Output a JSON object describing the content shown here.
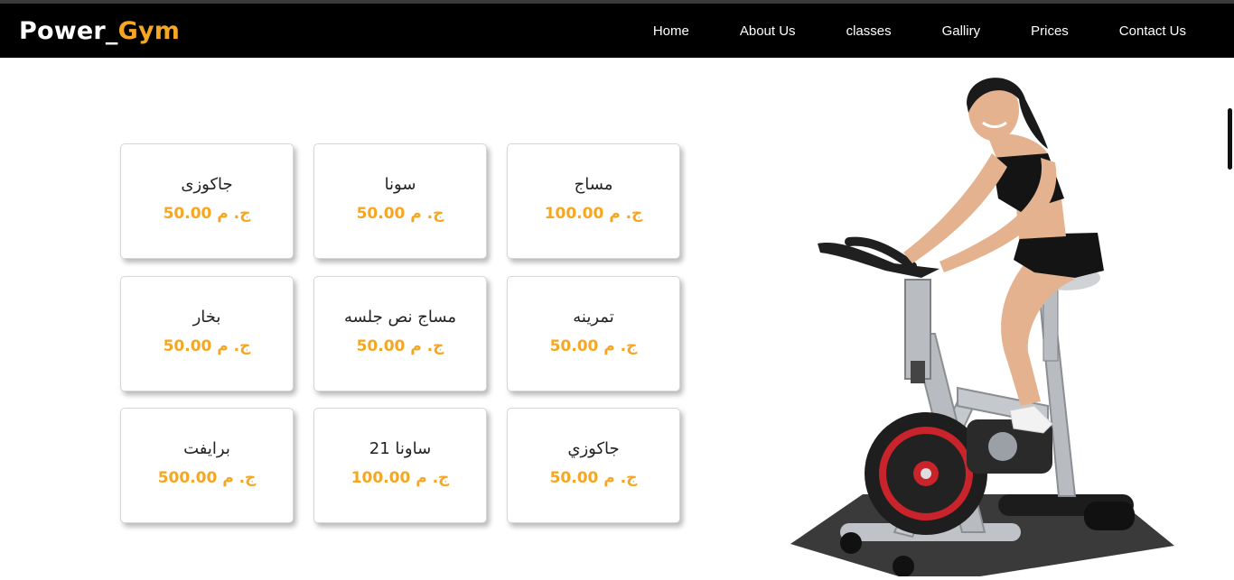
{
  "brand": {
    "main": "Power_",
    "accent": "Gym"
  },
  "nav": {
    "items": [
      {
        "label": "Home"
      },
      {
        "label": "About Us"
      },
      {
        "label": "classes"
      },
      {
        "label": "Galliry"
      },
      {
        "label": "Prices"
      },
      {
        "label": "Contact Us"
      }
    ]
  },
  "prices": {
    "rows": [
      [
        {
          "name": "جاكوزى",
          "price": "ج. م 50.00"
        },
        {
          "name": "سونا",
          "price": "ج. م 50.00"
        },
        {
          "name": "مساج",
          "price": "ج. م 100.00"
        }
      ],
      [
        {
          "name": "بخار",
          "price": "ج. م 50.00"
        },
        {
          "name": "مساج نص جلسه",
          "price": "ج. م 50.00"
        },
        {
          "name": "تمرينه",
          "price": "ج. م 50.00"
        }
      ],
      [
        {
          "name": "برايفت",
          "price": "ج. م 500.00"
        },
        {
          "name": "ساونا 21",
          "price": "ج. م 100.00"
        },
        {
          "name": "جاكوزي",
          "price": "ج. م 50.00"
        }
      ]
    ]
  },
  "colors": {
    "accent": "#f5a623",
    "navbar": "#000000"
  },
  "hero": {
    "icon": "woman-on-exercise-bike-image"
  }
}
